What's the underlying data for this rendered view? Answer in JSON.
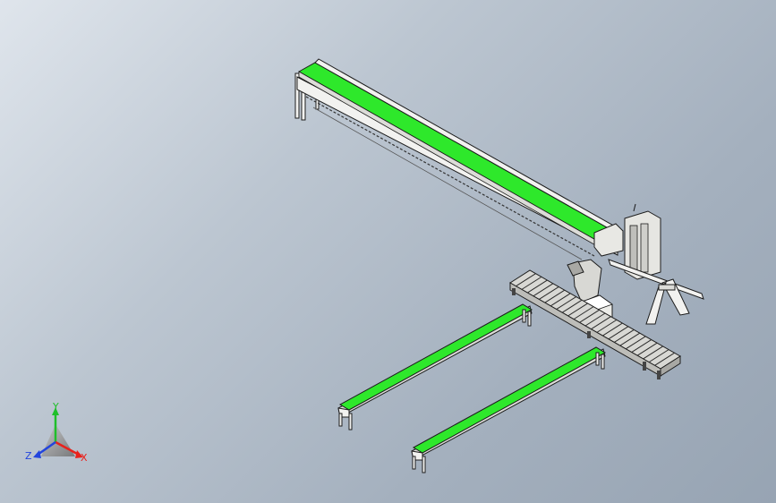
{
  "colors": {
    "belt": "#2ee82b",
    "belt_dark": "#1aa81a",
    "frame": "#f2f2f0",
    "frame_shade": "#b9b9b5",
    "outline": "#1c1c1c",
    "axis_x": "#e8221c",
    "axis_y": "#1fbf2a",
    "axis_z": "#2244dd"
  },
  "triad": {
    "x_label": "X",
    "y_label": "Y",
    "z_label": "Z"
  },
  "icons": [
    "view-orientation-triad-icon"
  ]
}
